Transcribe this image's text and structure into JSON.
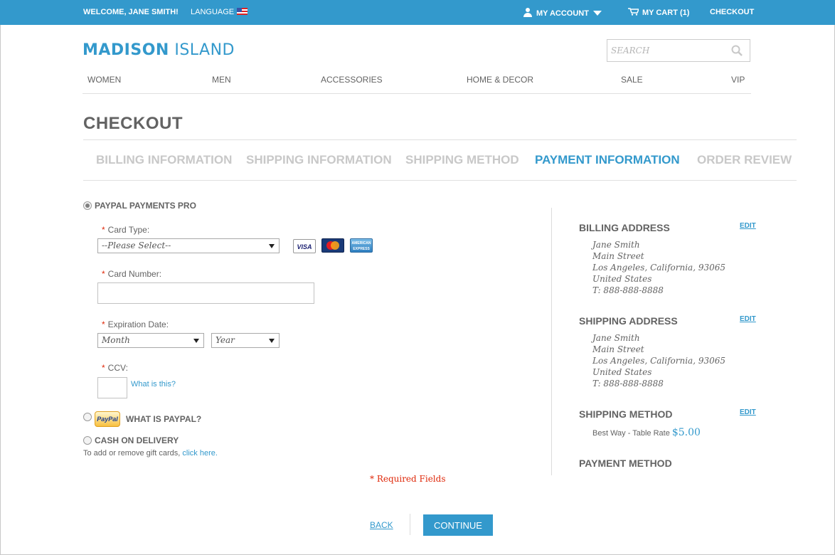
{
  "topbar": {
    "welcome": "WELCOME, JANE SMITH!",
    "language_label": "LANGUAGE",
    "my_account": "MY ACCOUNT",
    "my_cart": "MY CART (1)",
    "checkout": "CHECKOUT"
  },
  "header": {
    "logo_bold": "MADISON",
    "logo_light": "ISLAND",
    "search_placeholder": "Search"
  },
  "nav": {
    "items": [
      "WOMEN",
      "MEN",
      "ACCESSORIES",
      "HOME & DECOR",
      "SALE",
      "VIP"
    ]
  },
  "page_title": "CHECKOUT",
  "steps": {
    "items": [
      {
        "label": "BILLING INFORMATION",
        "active": false
      },
      {
        "label": "SHIPPING INFORMATION",
        "active": false
      },
      {
        "label": "SHIPPING METHOD",
        "active": false
      },
      {
        "label": "PAYMENT INFORMATION",
        "active": true
      },
      {
        "label": "ORDER REVIEW",
        "active": false
      }
    ]
  },
  "payment": {
    "options": {
      "paypal_pro": "PAYPAL PAYMENTS PRO",
      "paypal_badge": "PayPal",
      "what_is_paypal": "WHAT IS PAYPAL?",
      "cash_on_delivery": "CASH ON DELIVERY"
    },
    "selected_option": "PAYPAL PAYMENTS PRO",
    "required_mark": "*",
    "card_type": {
      "label": "Card Type:",
      "value": "--Please Select--"
    },
    "card_logos": {
      "visa": "VISA",
      "mastercard": "MC",
      "amex": "AMERICAN EXPRESS"
    },
    "card_number": {
      "label": "Card Number:",
      "value": ""
    },
    "expiration": {
      "label": "Expiration Date:",
      "month": "Month",
      "year": "Year"
    },
    "ccv": {
      "label": "CCV:",
      "value": "",
      "help_link": "What is this?"
    },
    "gift_text": "To add or remove gift cards,",
    "gift_link": "click here.",
    "required_fields": "* Required Fields"
  },
  "summary": {
    "billing_title": "BILLING ADDRESS",
    "shipping_title": "SHIPPING ADDRESS",
    "method_title": "SHIPPING METHOD",
    "payment_title": "PAYMENT METHOD",
    "edit_label": "EDIT",
    "billing_address": [
      "Jane Smith",
      "Main Street",
      "Los Angeles, California, 93065",
      "United States",
      "T: 888-888-8888"
    ],
    "shipping_address": [
      "Jane Smith",
      "Main Street",
      "Los Angeles, California, 93065",
      "United States",
      "T: 888-888-8888"
    ],
    "shipping_method": "Best Way - Table Rate",
    "shipping_price": "$5.00"
  },
  "actions": {
    "back": "BACK",
    "continue": "CONTINUE"
  },
  "colors": {
    "brand_blue": "#3399cc",
    "required_red": "#df280a",
    "text": "#636363",
    "step_inactive": "#c8c8c8"
  }
}
